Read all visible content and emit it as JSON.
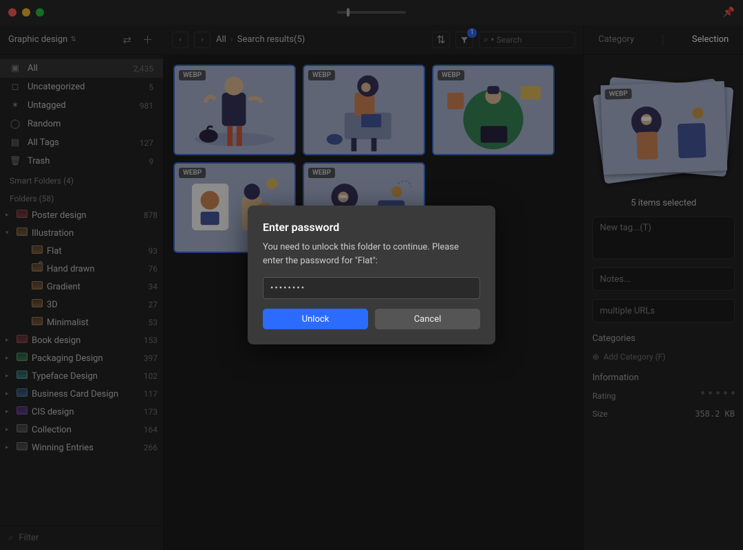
{
  "titlebar": {
    "pin_icon": "📌"
  },
  "toolbar": {
    "library_name": "Graphic design",
    "breadcrumb": {
      "root": "All",
      "current": "Search results(5)"
    },
    "filter_badge": "1",
    "search_placeholder": "Search",
    "tabs": {
      "category": "Category",
      "selection": "Selection"
    }
  },
  "sidebar": {
    "smart": [
      {
        "icon": "▣",
        "label": "All",
        "count": "2,435",
        "selected": true
      },
      {
        "icon": "◻",
        "label": "Uncategorized",
        "count": "5"
      },
      {
        "icon": "✶",
        "label": "Untagged",
        "count": "981"
      },
      {
        "icon": "◯",
        "label": "Random",
        "count": ""
      },
      {
        "icon": "▤",
        "label": "All Tags",
        "count": "127"
      },
      {
        "icon": "🗑",
        "label": "Trash",
        "count": "9"
      }
    ],
    "smart_folders_header": "Smart Folders (4)",
    "folders_header": "Folders (58)",
    "folders": [
      {
        "label": "Poster design",
        "count": "878",
        "color": "folder-red",
        "open": false
      },
      {
        "label": "Illustration",
        "count": "",
        "color": "folder-orange",
        "open": true,
        "children": [
          {
            "label": "Flat",
            "count": "93",
            "color": "folder-orange",
            "highlighted": true,
            "locked": true
          },
          {
            "label": "Hand drawn",
            "count": "76",
            "color": "folder-orange"
          },
          {
            "label": "Gradient",
            "count": "34",
            "color": "folder-orange"
          },
          {
            "label": "3D",
            "count": "27",
            "color": "folder-orange"
          },
          {
            "label": "Minimalist",
            "count": "53",
            "color": "folder-orange"
          }
        ]
      },
      {
        "label": "Book design",
        "count": "153",
        "color": "folder-red",
        "open": false
      },
      {
        "label": "Packaging Design",
        "count": "397",
        "color": "folder-green",
        "open": false
      },
      {
        "label": "Typeface Design",
        "count": "102",
        "color": "folder-teal",
        "open": false
      },
      {
        "label": "Business Card Design",
        "count": "117",
        "color": "folder-blue",
        "open": false
      },
      {
        "label": "CIS design",
        "count": "173",
        "color": "folder-purple",
        "open": false
      },
      {
        "label": "Collection",
        "count": "164",
        "color": "folder-gray",
        "open": false
      },
      {
        "label": "Winning Entries",
        "count": "266",
        "color": "folder-gray",
        "open": false
      }
    ],
    "filter_placeholder": "Filter"
  },
  "grid": {
    "badge": "WEBP",
    "items": [
      1,
      2,
      3,
      4,
      5
    ]
  },
  "inspector": {
    "preview_badge": "WEBP",
    "selected_text": "5 items selected",
    "tag_placeholder": "New tag...(T)",
    "notes_placeholder": "Notes...",
    "url_placeholder": "multiple URLs",
    "categories_header": "Categories",
    "add_category": "Add Category (F)",
    "info_header": "Information",
    "rating_label": "Rating",
    "size_label": "Size",
    "size_value": "358.2 KB"
  },
  "modal": {
    "title": "Enter password",
    "text": "You need to unlock this folder to continue. Please enter the password for \"Flat\":",
    "password_mask": "••••••••",
    "unlock": "Unlock",
    "cancel": "Cancel"
  }
}
